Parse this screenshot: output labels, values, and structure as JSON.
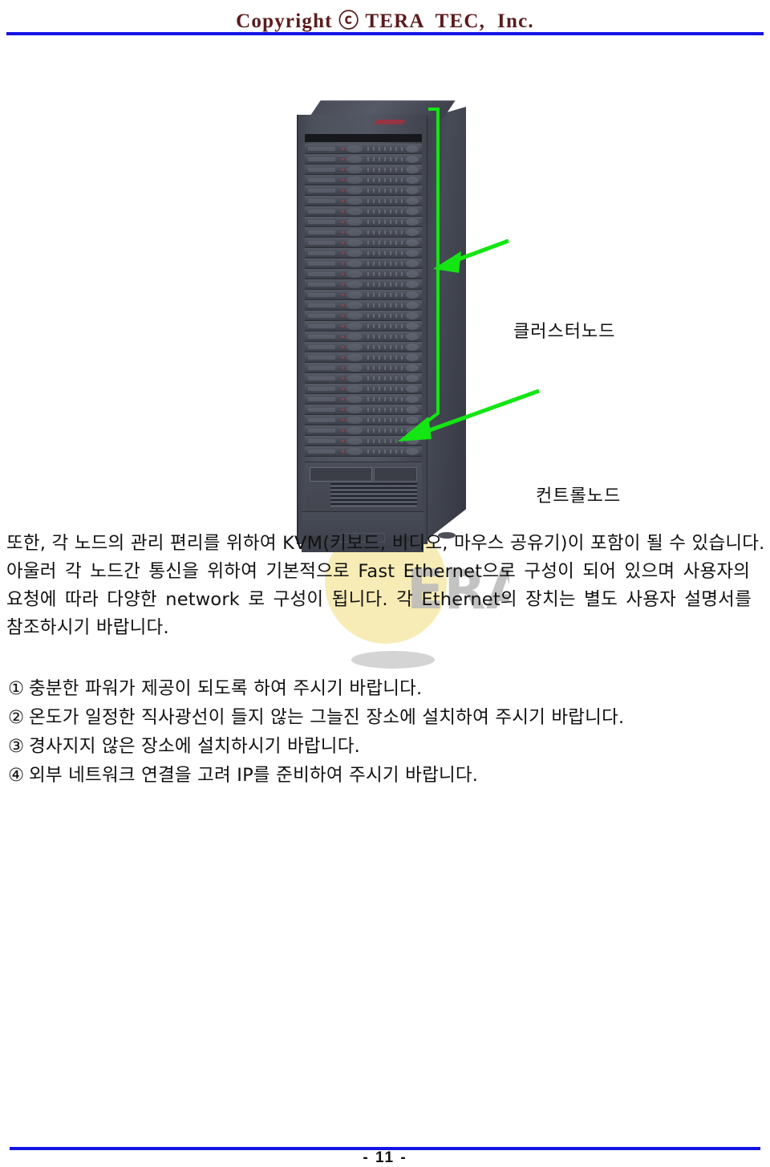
{
  "header": {
    "title": "Copyright ⓒ TERA  TEC,  Inc.",
    "rule_color": "#1414e6",
    "text_color": "#5b1b1d"
  },
  "figure": {
    "subject": "server-rack-photo",
    "annotation_color": "#13e613",
    "callouts": [
      {
        "id": "cluster-node",
        "label": "클러스터노드"
      },
      {
        "id": "control-node",
        "label": "컨트롤노드"
      }
    ],
    "watermark": {
      "text": "ERA",
      "circle_color": "#f2e08a",
      "letters_color": "#b8b8b8"
    }
  },
  "body": {
    "lines": [
      "또한, 각 노드의 관리 편리를 위하여 KVM(키보드, 비디오, 마우스 공유기)이 포함이 될 수 있습니다.",
      "아울러 각 노드간 통신을 위하여 기본적으로 Fast Ethernet으로 구성이 되어 있으며 사용자의",
      "요청에 따라 다양한 network 로 구성이 됩니다. 각 Ethernet의 장치는 별도 사용자 설명서를",
      "참조하시기 바랍니다."
    ]
  },
  "notices": [
    {
      "num": "①",
      "text": "충분한 파워가 제공이 되도록 하여 주시기 바랍니다."
    },
    {
      "num": "②",
      "text": "온도가 일정한 직사광선이 들지 않는 그늘진 장소에 설치하여 주시기 바랍니다."
    },
    {
      "num": "③",
      "text": "경사지지 않은 장소에 설치하시기 바랍니다."
    },
    {
      "num": "④",
      "text": "외부 네트워크 연결을 고려 IP를 준비하여 주시기 바랍니다."
    }
  ],
  "footer": {
    "page_number": "- 11 -",
    "rule_color": "#1414e6"
  }
}
